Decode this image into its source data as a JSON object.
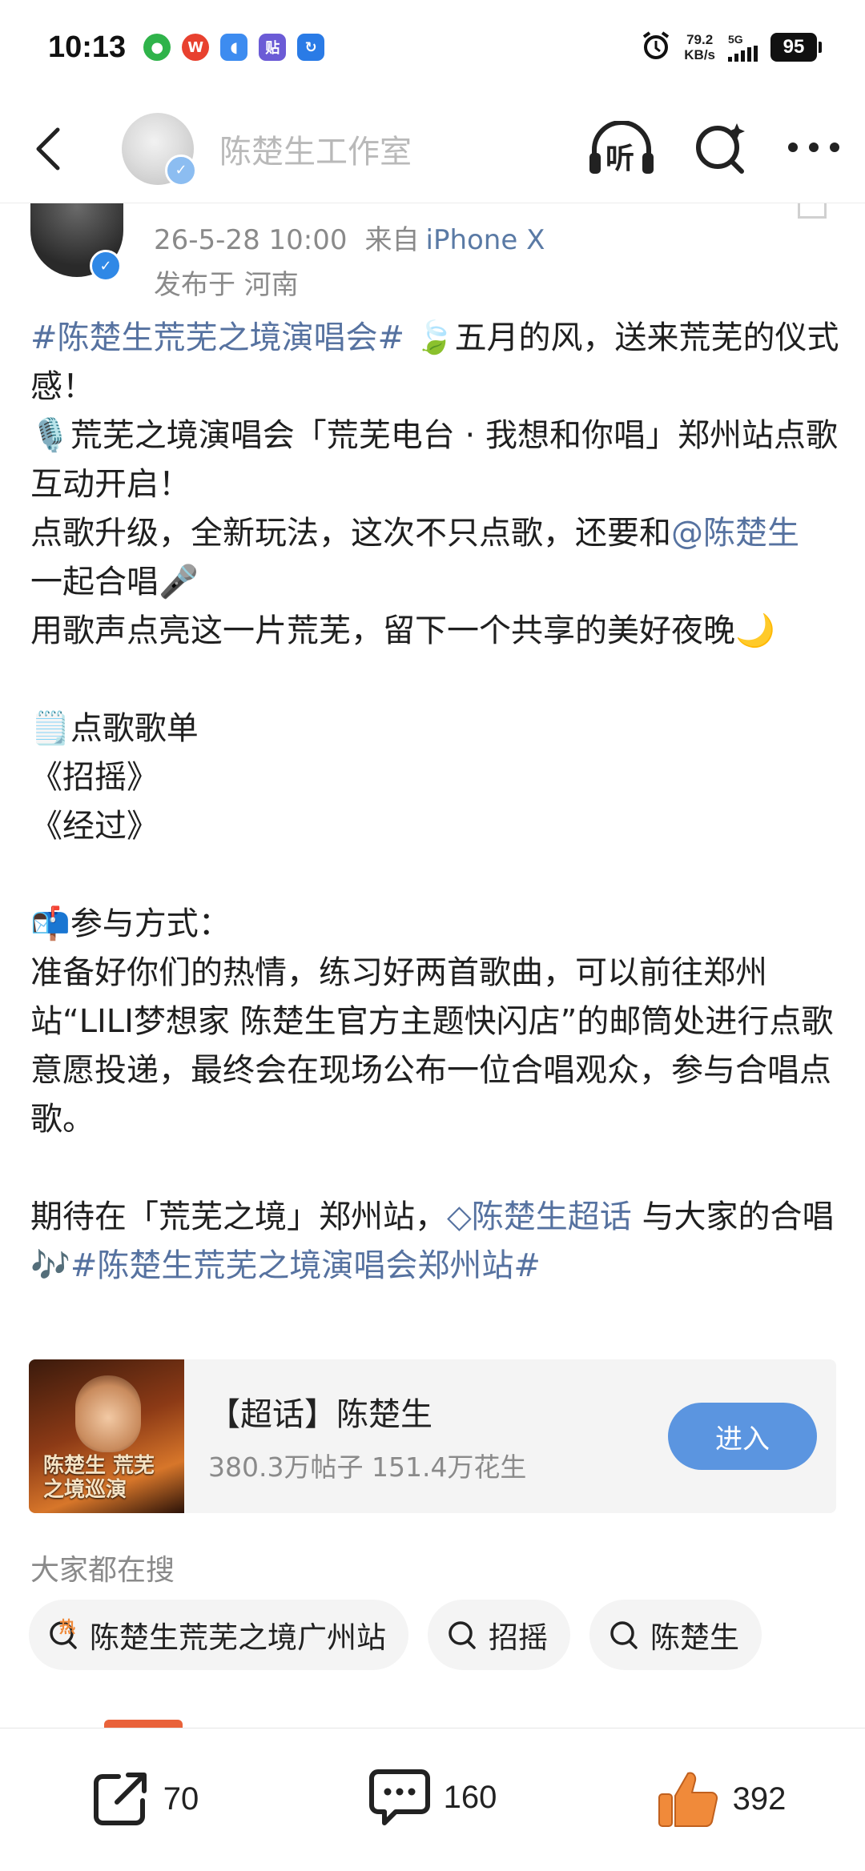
{
  "status_bar": {
    "time": "10:13",
    "net_speed_value": "79.2",
    "net_speed_unit": "KB/s",
    "network_type": "5G",
    "battery": "95",
    "notification_icons": [
      "app-icon",
      "weibo-icon",
      "chat-icon",
      "tieba-icon",
      "browser-icon"
    ],
    "tieba_label": "贴"
  },
  "nav": {
    "title": "陈楚生工作室",
    "listen_label": "听",
    "verified_mark": "✓"
  },
  "post": {
    "date": "26-5-28 10:00",
    "from_label": "来自",
    "device": "iPhone X",
    "location": "发布于 河南",
    "paragraphs": {
      "p1_tag": "#陈楚生荒芜之境演唱会#",
      "p1_emoji": "🍃",
      "p1_text": "五月的风，送来荒芜的仪式感！",
      "p2_emoji": "🎙️",
      "p2_text": "荒芜之境演唱会「荒芜电台 · 我想和你唱」郑州站点歌互动开启！",
      "p3_text": "点歌升级，全新玩法，这次不只点歌，还要和",
      "p3_mention": "@陈楚生",
      "p3_text2": " 一起合唱",
      "p3_emoji": "🎤",
      "p4_text": "用歌声点亮这一片荒芜，留下一个共享的美好夜晚",
      "p4_emoji": "🌙",
      "p5_emoji": "🗒️",
      "p5_text": "点歌歌单",
      "song1": "《招摇》",
      "song2": "《经过》",
      "p6_emoji": "📬",
      "p6_text": "参与方式：",
      "p7_text": "准备好你们的热情，练习好两首歌曲，可以前往郑州站“LILI梦想家 陈楚生官方主题快闪店”的邮筒处进行点歌意愿投递，最终会在现场公布一位合唱观众，参与合唱点歌。",
      "p8_text": "期待在「荒芜之境」郑州站，",
      "p8_chaohua_icon": "◇",
      "p8_chaohua": "陈楚生超话",
      "p8_text2": " 与大家的合唱",
      "p8_emoji": "🎶",
      "p8_tag": "#陈楚生荒芜之境演唱会郑州站#"
    }
  },
  "chaohua_card": {
    "title": "【超话】陈楚生",
    "stats": "380.3万帖子 151.4万花生",
    "enter_label": "进入",
    "poster_text": "陈楚生 荒芜之境巡演"
  },
  "search": {
    "heading": "大家都在搜",
    "hot_badge": "热",
    "chips": [
      "陈楚生荒芜之境广州站",
      "招摇",
      "陈楚生"
    ]
  },
  "actions": {
    "repost_count": "70",
    "comment_count": "160",
    "like_count": "392"
  },
  "colors": {
    "link": "#5672a0",
    "accent_button": "#5b95e0",
    "like_orange": "#f08a3a",
    "verified_blue": "#2f88e6"
  }
}
